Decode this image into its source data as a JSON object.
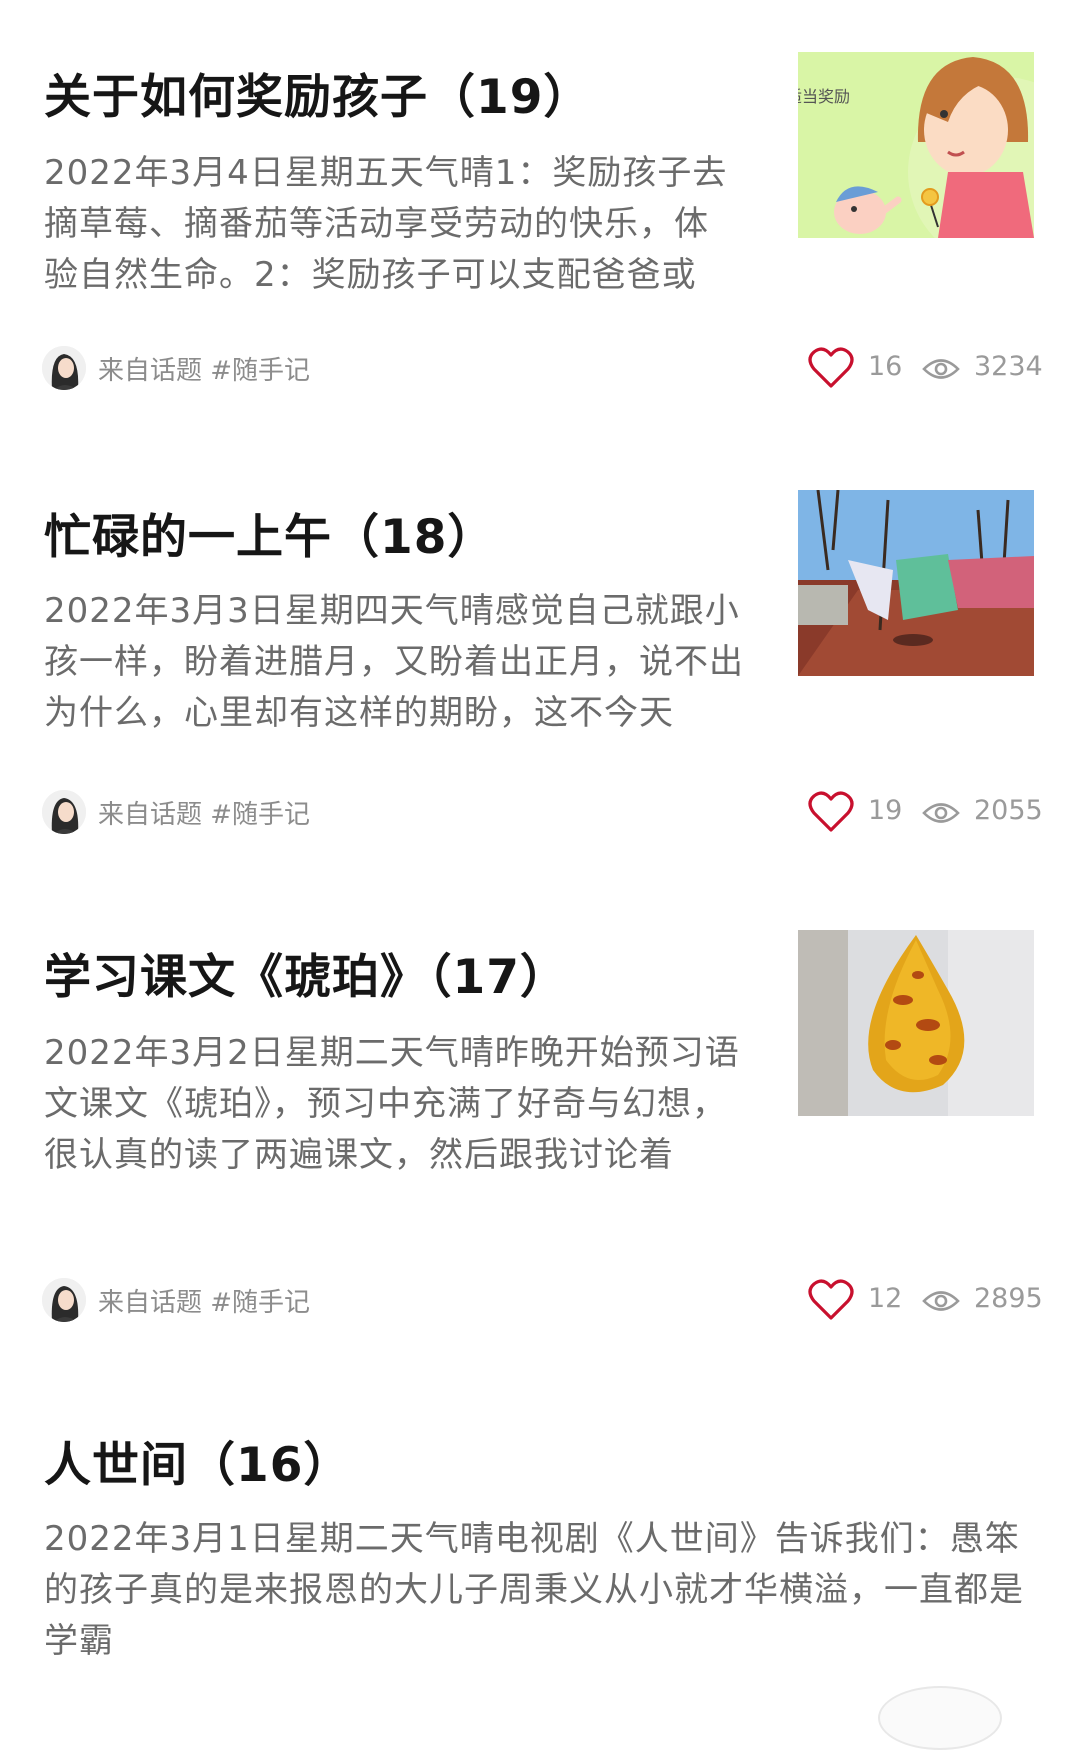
{
  "posts": [
    {
      "title": "关于如何奖励孩子（19）",
      "summary": "2022年3月4日星期五天气晴1：奖励孩子去摘草莓、摘番茄等活动享受劳动的快乐，体验自然生命。2：奖励孩子可以支配爸爸或",
      "thumb_text": "适当奖励",
      "source": "来自话题 #随手记",
      "likes": "16",
      "views": "3234"
    },
    {
      "title": "忙碌的一上午（18）",
      "summary": "2022年3月3日星期四天气晴感觉自己就跟小孩一样，盼着进腊月，又盼着出正月，说不出为什么，心里却有这样的期盼，这不今天",
      "source": "来自话题 #随手记",
      "likes": "19",
      "views": "2055"
    },
    {
      "title": "学习课文《琥珀》（17）",
      "summary": "2022年3月2日星期二天气晴昨晚开始预习语文课文《琥珀》，预习中充满了好奇与幻想，很认真的读了两遍课文，然后跟我讨论着",
      "source": "来自话题 #随手记",
      "likes": "12",
      "views": "2895"
    },
    {
      "title": "人世间（16）",
      "summary": "2022年3月1日星期二天气晴电视剧《人世间》告诉我们：愚笨的孩子真的是来报恩的大儿子周秉义从小就才华横溢，一直都是学霸"
    }
  ],
  "icons": {
    "like": "heart-outline-icon",
    "views": "eye-icon"
  },
  "colors": {
    "like": "#c8102e",
    "meta": "#8c8c8c"
  }
}
